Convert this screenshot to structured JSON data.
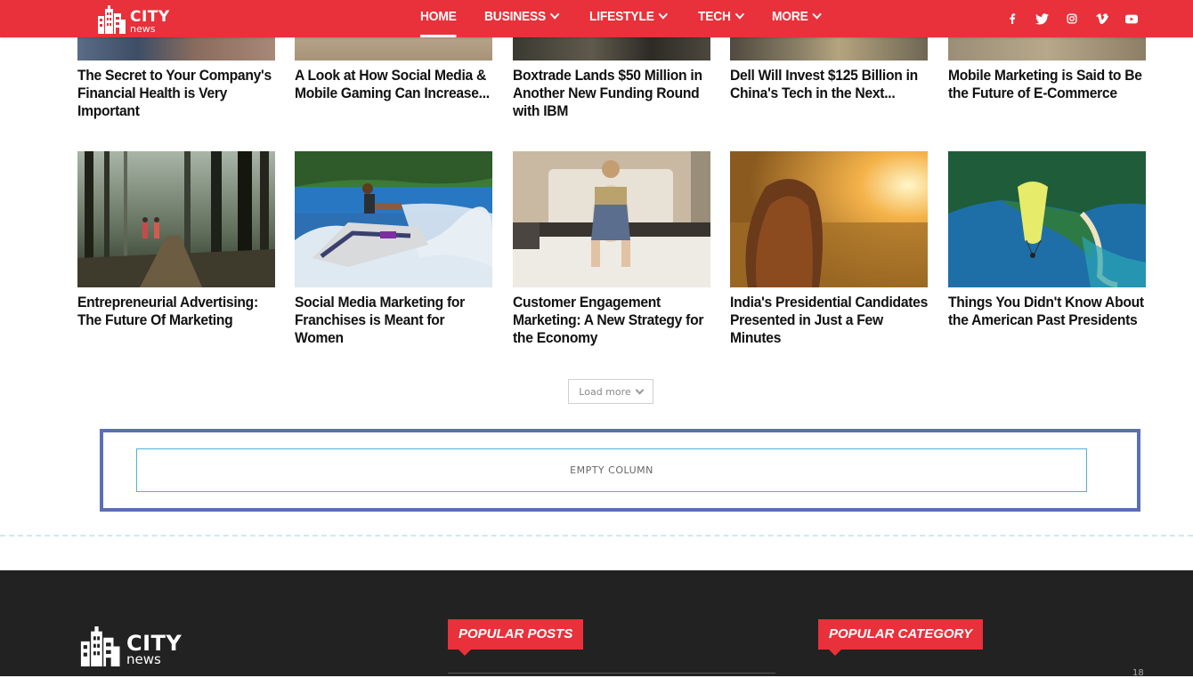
{
  "header": {
    "logo": {
      "city": "CITY",
      "news": "news"
    },
    "nav": [
      {
        "label": "HOME",
        "active": true,
        "dropdown": false
      },
      {
        "label": "BUSINESS",
        "active": false,
        "dropdown": true
      },
      {
        "label": "LIFESTYLE",
        "active": false,
        "dropdown": true
      },
      {
        "label": "TECH",
        "active": false,
        "dropdown": true
      },
      {
        "label": "MORE",
        "active": false,
        "dropdown": true
      }
    ],
    "social": [
      "facebook-icon",
      "twitter-icon",
      "instagram-icon",
      "vimeo-icon",
      "youtube-icon"
    ],
    "accent_color": "#e8313a"
  },
  "top_row": [
    {
      "title": "The Secret to Your Company's Financial Health is Very Important"
    },
    {
      "title": "A Look at How Social Media & Mobile Gaming Can Increase..."
    },
    {
      "title": "Boxtrade Lands $50 Million in Another New Funding Round with IBM"
    },
    {
      "title": "Dell Will Invest $125 Billion in China's Tech in the Next..."
    },
    {
      "title": "Mobile Marketing is Said to Be the Future of E-Commerce"
    }
  ],
  "second_row": [
    {
      "title": "Entrepreneurial Advertising: The Future Of Marketing",
      "image": "misty-forest"
    },
    {
      "title": "Social Media Marketing for Franchises is Meant for Women",
      "image": "jet-ski"
    },
    {
      "title": "Customer Engagement Marketing: A New Strategy for the Economy",
      "image": "woman-flowers-bed"
    },
    {
      "title": "India's Presidential Candidates Presented in Just a Few Minutes",
      "image": "sunset-field"
    },
    {
      "title": "Things You Didn't Know About the American Past Presidents",
      "image": "paraglider-island"
    }
  ],
  "load_more": "Load more",
  "empty_column": "EMPTY COLUMN",
  "footer": {
    "logo": {
      "city": "CITY",
      "news": "news"
    },
    "popular_posts": "POPULAR POSTS",
    "popular_category": "POPULAR CATEGORY",
    "count": "18"
  }
}
